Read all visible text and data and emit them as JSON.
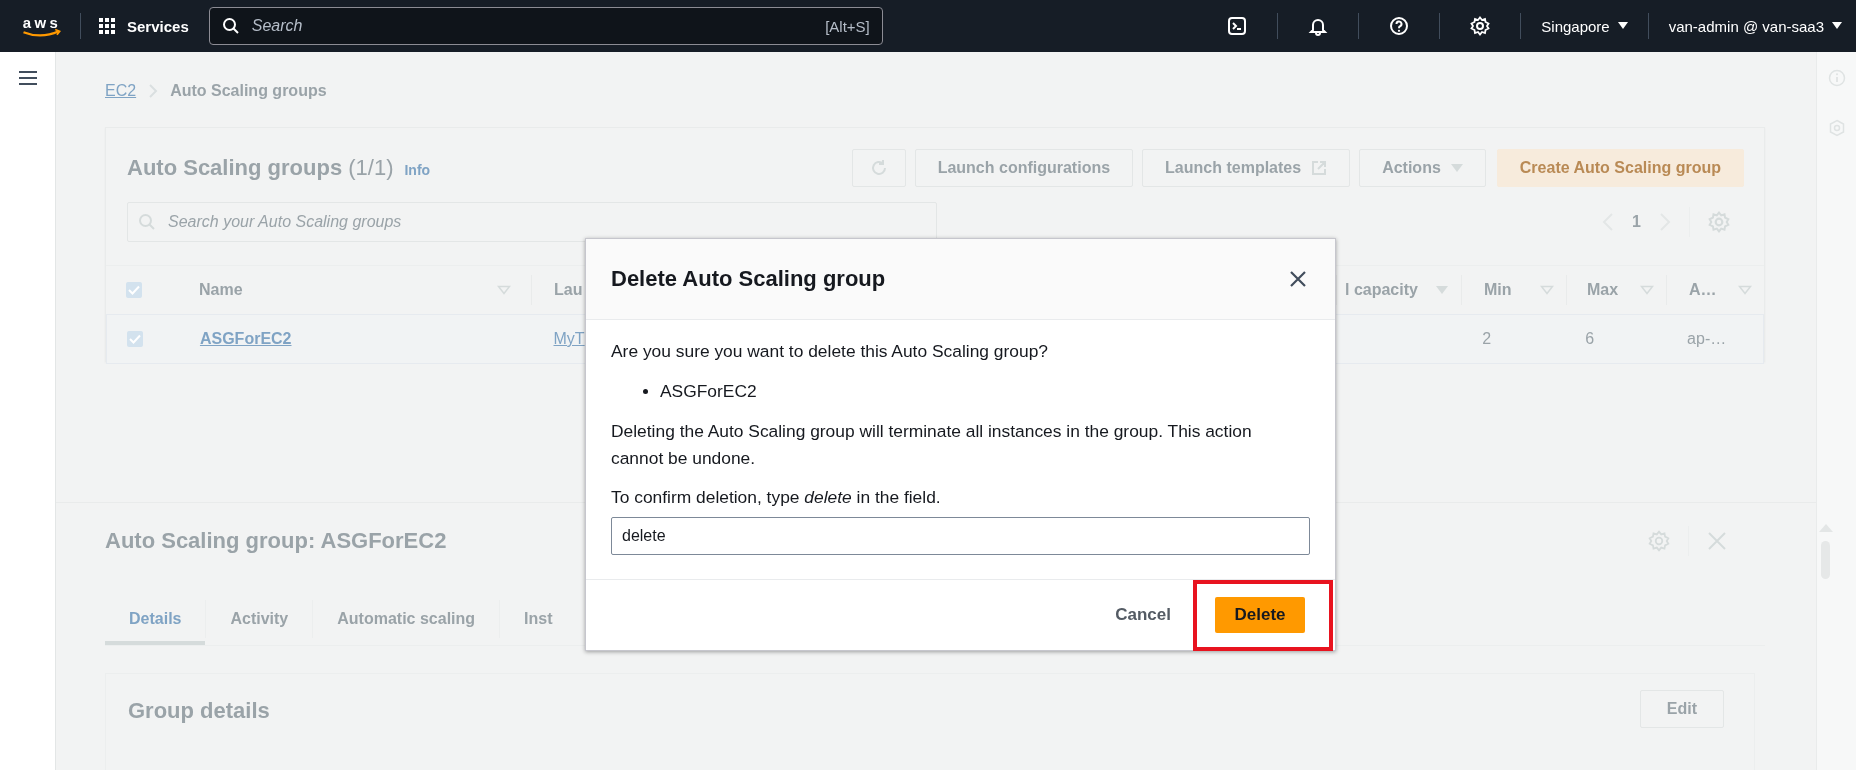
{
  "top_nav": {
    "logo_text": "aws",
    "services_label": "Services",
    "search": {
      "placeholder": "Search",
      "shortcut": "[Alt+S]"
    },
    "region": "Singapore",
    "account": "van-admin @ van-saa3"
  },
  "breadcrumb": [
    {
      "label": "EC2",
      "kind": "link"
    },
    {
      "label": "Auto Scaling groups",
      "kind": "current"
    }
  ],
  "groups_panel": {
    "title": "Auto Scaling groups",
    "count": "(1/1)",
    "info": "Info",
    "buttons": [
      {
        "label": "Launch configurations",
        "kind": "default"
      },
      {
        "label": "Launch templates",
        "kind": "external"
      },
      {
        "label": "Actions",
        "kind": "dropdown"
      },
      {
        "label": "Create Auto Scaling group",
        "kind": "primary"
      }
    ],
    "search": {
      "placeholder": "Search your Auto Scaling groups"
    },
    "page": "1",
    "table": {
      "all_checked": true,
      "columns": [
        {
          "label": "Name"
        },
        {
          "label": "Lau"
        },
        {
          "label": "l capacity"
        },
        {
          "label": "Min"
        },
        {
          "label": "Max"
        },
        {
          "label": "A…"
        }
      ],
      "rows": [
        {
          "checked": true,
          "name": "ASGForEC2",
          "column_2": "MyT",
          "min": "2",
          "max": "6",
          "column_6": "ap-…"
        }
      ]
    }
  },
  "detail_panel": {
    "title": "Auto Scaling group: ASGForEC2",
    "tabs": [
      {
        "label": "Details",
        "selected": true
      },
      {
        "label": "Activity",
        "selected": false
      },
      {
        "label": "Automatic scaling",
        "selected": false
      },
      {
        "label": "Inst",
        "selected": false
      }
    ],
    "section_title": "Group details",
    "edit_label": "Edit"
  },
  "dialog": {
    "title": "Delete Auto Scaling group",
    "question": "Are you sure you want to delete this Auto Scaling group?",
    "items": [
      "ASGForEC2"
    ],
    "warning": "Deleting the Auto Scaling group will terminate all instances in the group. This action cannot be undone.",
    "confirm_prompt": "To confirm deletion, type *delete* in the field.",
    "input_value": "delete",
    "cancel_label": "Cancel",
    "delete_label": "Delete",
    "delete_highlighted": true
  }
}
